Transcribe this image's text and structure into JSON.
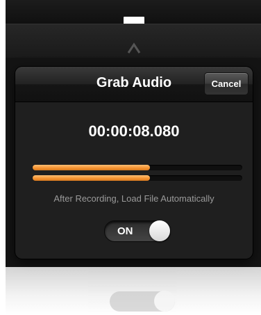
{
  "popover": {
    "title": "Grab Audio",
    "cancel_label": "Cancel",
    "timecode": "00:00:08.080",
    "meters": [
      {
        "channel": "left",
        "level": 0.56
      },
      {
        "channel": "right",
        "level": 0.56
      }
    ],
    "auto_load_label": "After Recording, Load File Automatically",
    "auto_load_toggle": {
      "state_label": "ON",
      "on": true
    }
  },
  "colors": {
    "meter_fill": "#f5922f",
    "popover_bg": "#1f1f1f",
    "hint_text": "#9a9a9a"
  },
  "icons": {
    "background_caret": "chevron-up-icon"
  }
}
